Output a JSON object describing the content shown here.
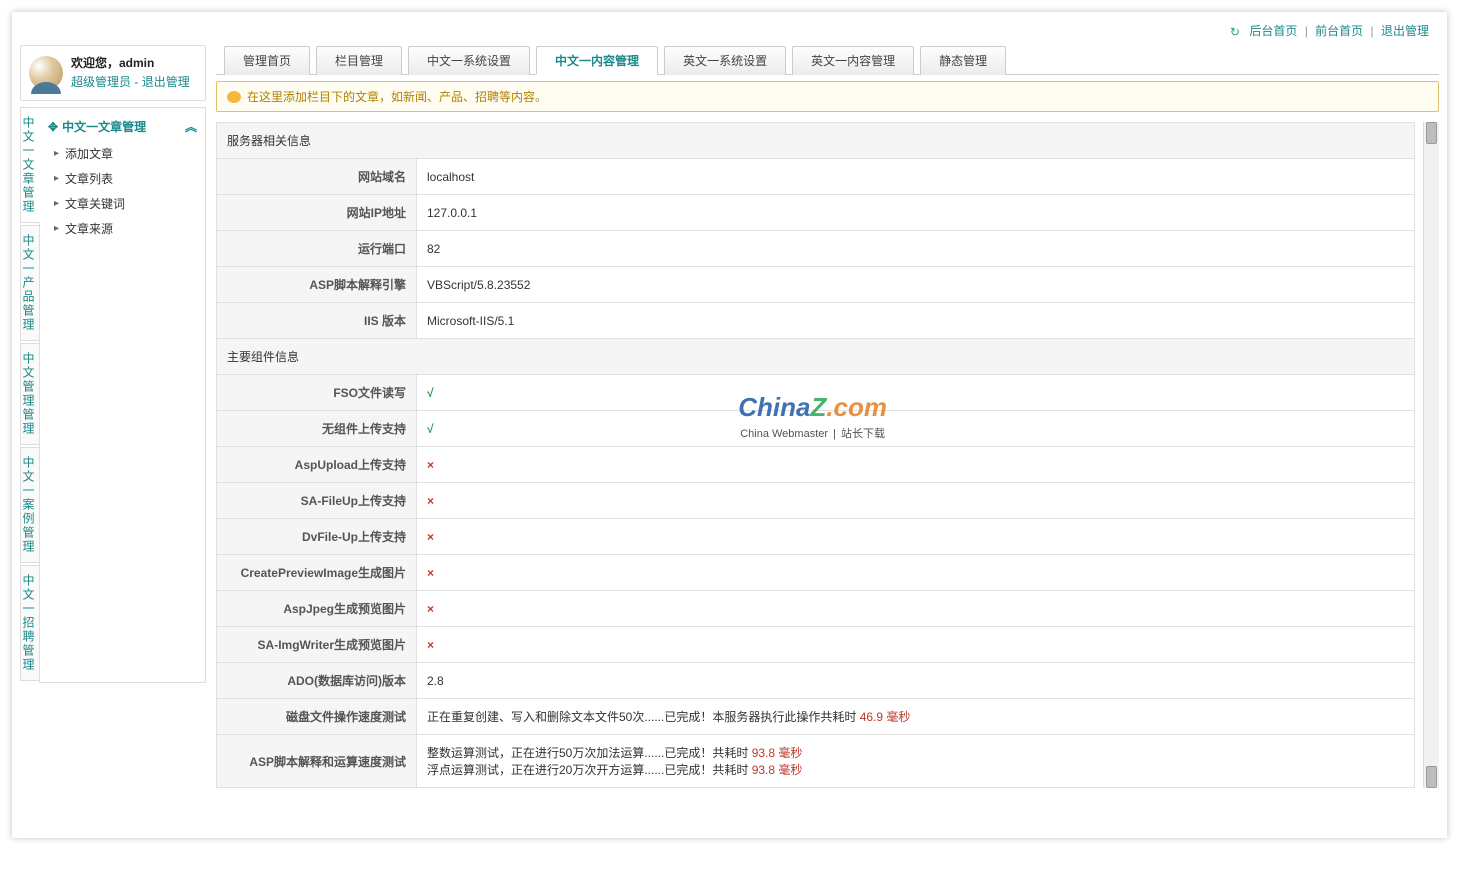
{
  "topLinks": {
    "backHome": "后台首页",
    "frontHome": "前台首页",
    "logout": "退出管理"
  },
  "welcome": {
    "greeting": "欢迎您，admin",
    "role": "超级管理员",
    "sep": " - ",
    "exit": "退出管理"
  },
  "vtabs": [
    "中文一文章管理",
    "中文一产品管理",
    "中文管理管理",
    "中文一案例管理",
    "中文一招聘管理"
  ],
  "tree": {
    "header": "中文一文章管理",
    "items": [
      "添加文章",
      "文章列表",
      "文章关键词",
      "文章来源"
    ]
  },
  "tabs": [
    "管理首页",
    "栏目管理",
    "中文一系统设置",
    "中文一内容管理",
    "英文一系统设置",
    "英文一内容管理",
    "静态管理"
  ],
  "activeTab": 3,
  "notice": "在这里添加栏目下的文章，如新闻、产品、招聘等内容。",
  "sectionA": "服务器相关信息",
  "serverRows": [
    {
      "label": "网站域名",
      "value": "localhost"
    },
    {
      "label": "网站IP地址",
      "value": "127.0.0.1"
    },
    {
      "label": "运行端口",
      "value": "82"
    },
    {
      "label": "ASP脚本解释引擎",
      "value": "VBScript/5.8.23552"
    },
    {
      "label": "IIS 版本",
      "value": "Microsoft-IIS/5.1"
    }
  ],
  "sectionB": "主要组件信息",
  "compRows": [
    {
      "label": "FSO文件读写",
      "check": "√"
    },
    {
      "label": "无组件上传支持",
      "check": "√"
    },
    {
      "label": "AspUpload上传支持",
      "check": "×"
    },
    {
      "label": "SA-FileUp上传支持",
      "check": "×"
    },
    {
      "label": "DvFile-Up上传支持",
      "check": "×"
    },
    {
      "label": "CreatePreviewImage生成图片",
      "check": "×"
    },
    {
      "label": "AspJpeg生成预览图片",
      "check": "×"
    },
    {
      "label": "SA-ImgWriter生成预览图片",
      "check": "×"
    }
  ],
  "adoRow": {
    "label": "ADO(数据库访问)版本",
    "value": "2.8"
  },
  "diskRow": {
    "label": "磁盘文件操作速度测试",
    "prefix": "正在重复创建、写入和删除文本文件50次......已完成！本服务器执行此操作共耗时 ",
    "time": "46.9 毫秒"
  },
  "aspRow": {
    "label": "ASP脚本解释和运算速度测试",
    "line1Prefix": "整数运算测试，正在进行50万次加法运算......已完成！共耗时 ",
    "line1Time": "93.8 毫秒",
    "line2Prefix": "浮点运算测试，正在进行20万次开方运算......已完成！共耗时 ",
    "line2Time": "93.8 毫秒"
  },
  "watermark": {
    "cn": "China",
    "z": "Z",
    "com": ".com",
    "sub1": "China Webmaster",
    "sub2": "站长下载"
  }
}
